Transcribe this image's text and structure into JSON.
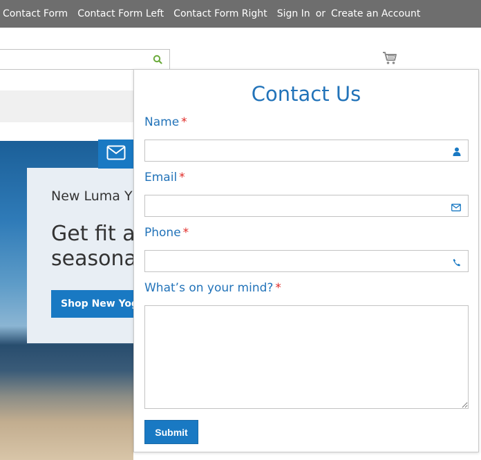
{
  "topbar": {
    "links": [
      "Contact Form",
      "Contact Form Left",
      "Contact Form Right",
      "Sign In"
    ],
    "or_text": "or",
    "create_account": "Create an Account"
  },
  "search": {
    "value": "",
    "placeholder": ""
  },
  "hero": {
    "subtitle": "New Luma Y",
    "title_line1": "Get fit ar",
    "title_line2": "seasona",
    "button": "Shop New Yoga"
  },
  "contact": {
    "title": "Contact Us",
    "required_mark": "*",
    "name_label": "Name",
    "email_label": "Email",
    "phone_label": "Phone",
    "message_label": "What’s on your mind?",
    "name_value": "",
    "email_value": "",
    "phone_value": "",
    "message_value": "",
    "submit_label": "Submit"
  },
  "colors": {
    "topbar_bg": "#6e6e6e",
    "accent": "#1979c3",
    "label_blue": "#2273b9",
    "required_red": "#e02b27",
    "search_icon_green": "#6aaa3a"
  },
  "icons": {
    "search": "search-icon",
    "cart": "cart-icon",
    "envelope_tab": "envelope-icon",
    "name_field": "user-icon",
    "email_field": "envelope-icon",
    "phone_field": "phone-icon"
  }
}
